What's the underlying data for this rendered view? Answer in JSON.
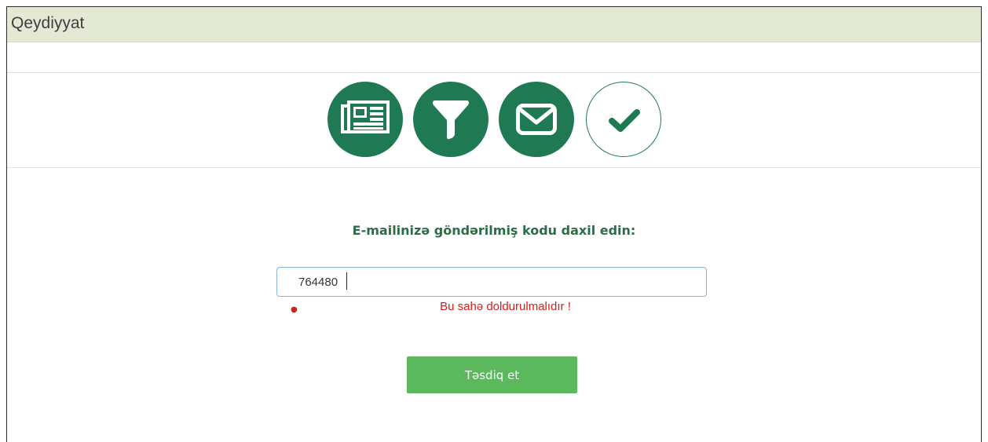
{
  "panel": {
    "title": "Qeydiyyat"
  },
  "steps": [
    {
      "icon": "newspaper-icon",
      "state": "completed"
    },
    {
      "icon": "filter-icon",
      "state": "completed"
    },
    {
      "icon": "envelope-icon",
      "state": "completed"
    },
    {
      "icon": "checkmark-icon",
      "state": "current"
    }
  ],
  "form": {
    "prompt": "E-mailinizə göndərilmiş kodu daxil edin:",
    "code_value": "764480",
    "error_message": "Bu sahə doldurulmalıdır !",
    "submit_label": "Təsdiq et"
  },
  "colors": {
    "header_bg": "#e4e9d6",
    "step_green": "#1f7a53",
    "prompt_green": "#2e6b47",
    "button_green": "#5cb85c",
    "error_red": "#d81b1b"
  }
}
